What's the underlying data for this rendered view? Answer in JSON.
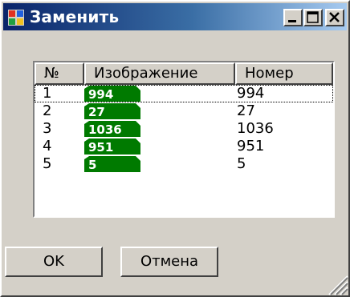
{
  "window": {
    "title": "Заменить"
  },
  "list": {
    "columns": [
      "№",
      "Изображение",
      "Номер"
    ],
    "rows": [
      {
        "n": "1",
        "plate": "994",
        "number": "994",
        "selected": true
      },
      {
        "n": "2",
        "plate": "27",
        "number": "27",
        "selected": false
      },
      {
        "n": "3",
        "plate": "1036",
        "number": "1036",
        "selected": false
      },
      {
        "n": "4",
        "plate": "951",
        "number": "951",
        "selected": false
      },
      {
        "n": "5",
        "plate": "5",
        "number": "5",
        "selected": false
      }
    ]
  },
  "buttons": {
    "ok": "OK",
    "cancel": "Отмена"
  },
  "colors": {
    "plate_fill": "#007a00",
    "titlebar_start": "#0a246a",
    "titlebar_end": "#a6caf0"
  },
  "icons": {
    "app": "window-app-icon",
    "minimize": "minimize-icon",
    "maximize": "maximize-icon",
    "close": "close-icon",
    "grip": "resize-grip-icon"
  }
}
